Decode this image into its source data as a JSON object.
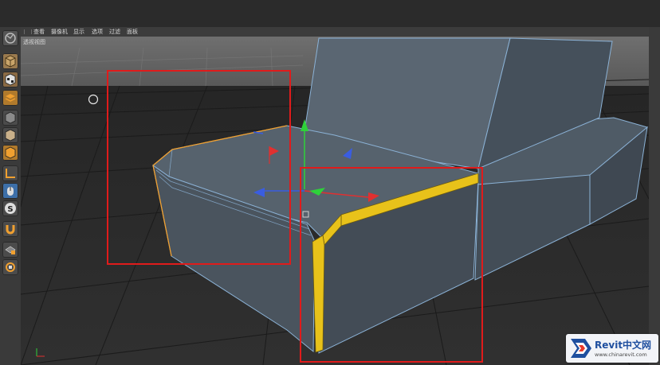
{
  "viewport_menu": {
    "items": [
      "查看",
      "摄像机",
      "显示",
      "选项",
      "过滤",
      "面板"
    ]
  },
  "viewport": {
    "label": "透视视图"
  },
  "toolbar": {
    "icons": [
      "undo-icon",
      "cube-icon",
      "checker-cube-icon",
      "layers-icon",
      "cube-outline-icon",
      "cube-shaded-icon",
      "cube-orange-icon",
      "workplane-icon",
      "mouse-icon",
      "snap-s-icon",
      "magnet-icon",
      "lock-grid-icon",
      "lock-axis-icon"
    ]
  },
  "selection_boxes": {
    "color": "#e01b1b"
  },
  "selected_edge": {
    "color": "#e8c21a"
  },
  "watermark": {
    "brand": "Revit中文网",
    "url": "www.chinarevit.com"
  }
}
